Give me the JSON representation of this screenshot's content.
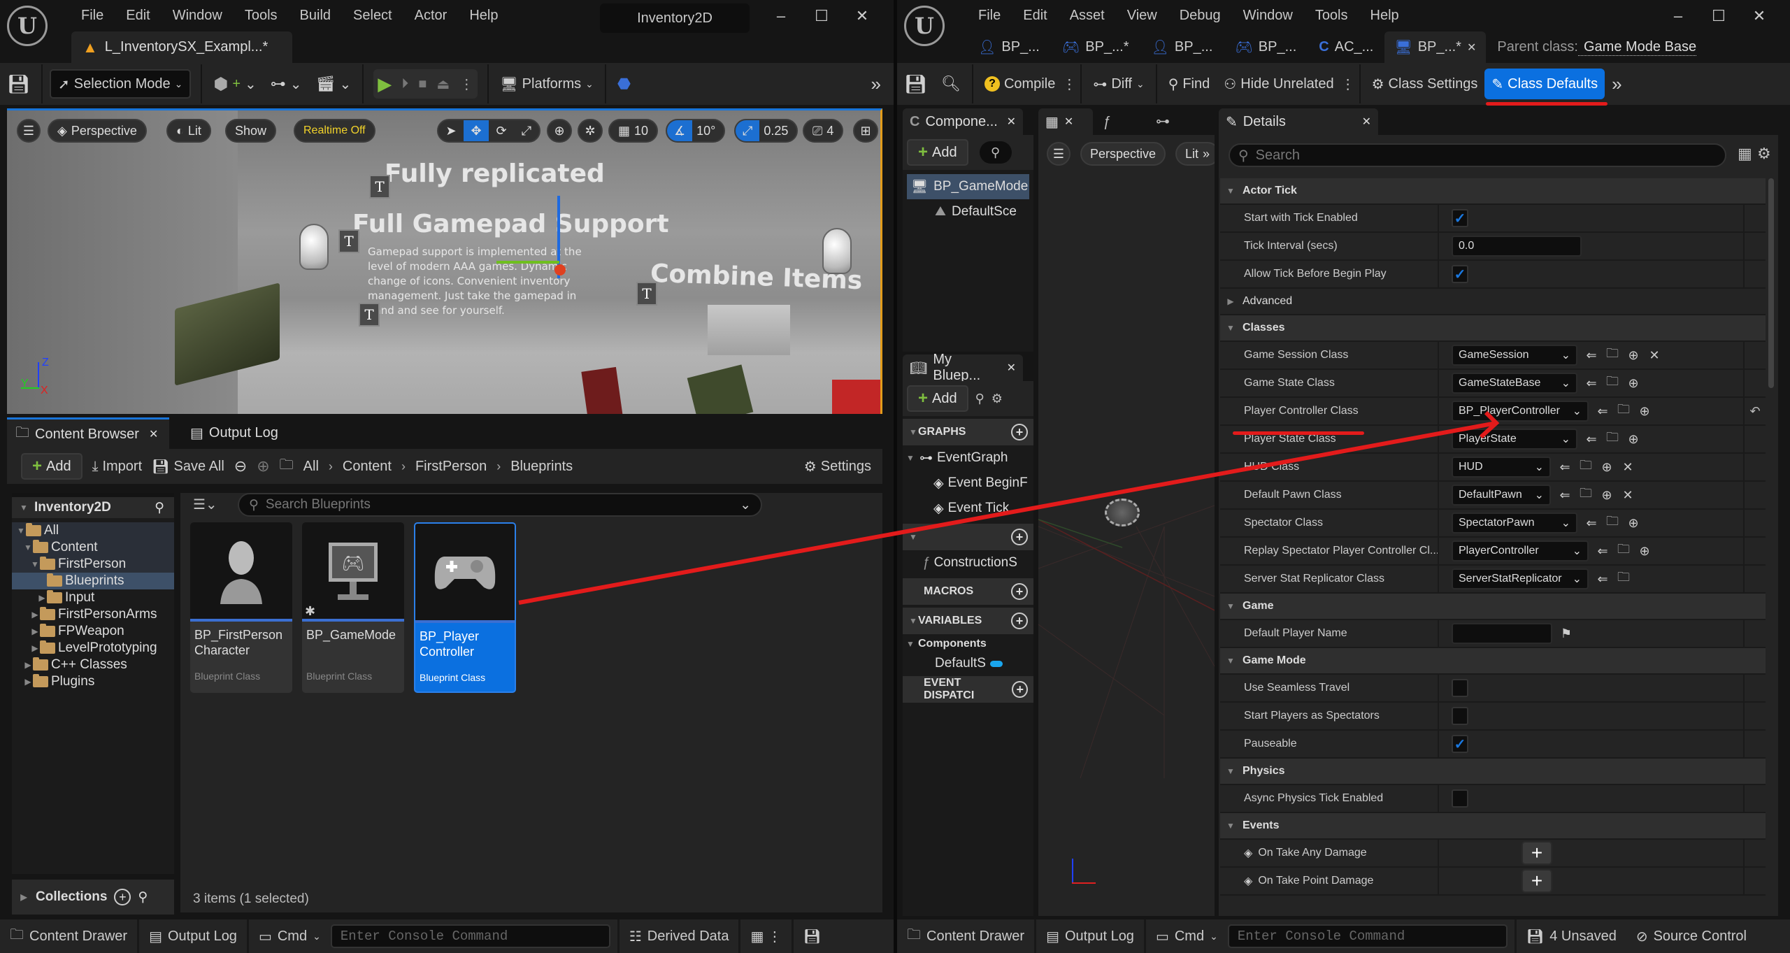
{
  "left_window": {
    "menu": [
      "File",
      "Edit",
      "Window",
      "Tools",
      "Build",
      "Select",
      "Actor",
      "Help"
    ],
    "title": "Inventory2D",
    "doc_tab": "L_InventorySX_Exampl...*",
    "toolbar": {
      "selection_mode": "Selection Mode",
      "platforms": "Platforms"
    },
    "viewport": {
      "perspective": "Perspective",
      "lit": "Lit",
      "show": "Show",
      "realtime": "Realtime Off",
      "grid_snap": "10",
      "rotation_snap": "10°",
      "scale_snap": "0.25",
      "camera_speed": "4",
      "scene_texts": {
        "fully_replicated": "Fully replicated",
        "gamepad_title": "Full Gamepad Support",
        "gamepad_body": "Gamepad support is implemented at the level of modern AAA games. Dynamic change of icons. Convenient inventory management. Just take the gamepad in hand and see for yourself.",
        "combine": "Combine Items"
      },
      "axis": {
        "x": "X",
        "y": "Y",
        "z": "Z"
      }
    },
    "content_browser": {
      "tab_label": "Content Browser",
      "output_log_tab": "Output Log",
      "add": "Add",
      "import": "Import",
      "save_all": "Save All",
      "breadcrumb": [
        "All",
        "Content",
        "FirstPerson",
        "Blueprints"
      ],
      "settings": "Settings",
      "tree_root": "Inventory2D",
      "search_placeholder": "Search Blueprints",
      "tree": [
        {
          "label": "All",
          "expanded": true,
          "selected": false
        },
        {
          "label": "Content",
          "expanded": true,
          "selected": false
        },
        {
          "label": "FirstPerson",
          "expanded": true,
          "selected": false
        },
        {
          "label": "Blueprints",
          "expanded": false,
          "selected": true
        },
        {
          "label": "Input",
          "expanded": false,
          "selected": false
        },
        {
          "label": "FirstPersonArms",
          "expanded": false,
          "selected": false
        },
        {
          "label": "FPWeapon",
          "expanded": false,
          "selected": false
        },
        {
          "label": "LevelPrototyping",
          "expanded": false,
          "selected": false
        },
        {
          "label": "C++ Classes",
          "expanded": false,
          "selected": false
        },
        {
          "label": "Plugins",
          "expanded": false,
          "selected": false
        }
      ],
      "assets": [
        {
          "name": "BP_FirstPerson Character",
          "type": "Blueprint Class",
          "icon": "character-icon",
          "selected": false
        },
        {
          "name": "BP_GameMode",
          "type": "Blueprint Class",
          "icon": "game-mode-icon",
          "selected": false
        },
        {
          "name": "BP_Player Controller",
          "type": "Blueprint Class",
          "icon": "gamepad-icon",
          "selected": true
        }
      ],
      "collections": "Collections",
      "item_count": "3 items (1 selected)"
    },
    "statusbar": {
      "content_drawer": "Content Drawer",
      "output_log": "Output Log",
      "cmd": "Cmd",
      "console_placeholder": "Enter Console Command",
      "derived_data": "Derived Data"
    }
  },
  "right_window": {
    "menu": [
      "File",
      "Edit",
      "Asset",
      "View",
      "Debug",
      "Window",
      "Tools",
      "Help"
    ],
    "tabs": [
      {
        "label": "BP_...",
        "icon": "character-icon"
      },
      {
        "label": "BP_...*",
        "icon": "gamepad-icon"
      },
      {
        "label": "BP_...",
        "icon": "character-icon"
      },
      {
        "label": "BP_...",
        "icon": "gamepad-icon"
      },
      {
        "label": "AC_...",
        "icon": "component-icon"
      },
      {
        "label": "BP_...*",
        "icon": "game-mode-icon",
        "active": true
      }
    ],
    "parent_class_label": "Parent class:",
    "parent_class_value": "Game Mode Base",
    "toolbar": {
      "compile": "Compile",
      "diff": "Diff",
      "find": "Find",
      "hide_unrelated": "Hide Unrelated",
      "class_settings": "Class Settings",
      "class_defaults": "Class Defaults"
    },
    "components": {
      "tab": "Compone...",
      "add": "Add",
      "items": [
        "BP_GameMode",
        "DefaultSce"
      ]
    },
    "viewport": {
      "perspective": "Perspective",
      "lit": "Lit"
    },
    "my_blueprint": {
      "tab": "My Bluep...",
      "add": "Add",
      "graphs_header": "GRAPHS",
      "event_graph": "EventGraph",
      "events": [
        "Event BeginF",
        "Event Tick"
      ],
      "functions": [
        "ConstructionS"
      ],
      "macros_header": "MACROS",
      "variables_header": "VARIABLES",
      "components_group": "Components",
      "variable_items": [
        "DefaultS"
      ],
      "dispatchers_header": "EVENT DISPATCI"
    },
    "details": {
      "tab": "Details",
      "search_placeholder": "Search",
      "categories": [
        {
          "name": "Actor Tick",
          "rows": [
            {
              "label": "Start with Tick Enabled",
              "kind": "check",
              "value": true
            },
            {
              "label": "Tick Interval (secs)",
              "kind": "number",
              "value": "0.0"
            },
            {
              "label": "Allow Tick Before Begin Play",
              "kind": "check",
              "value": true
            }
          ]
        },
        {
          "name": "Advanced",
          "collapsed": true,
          "rows": []
        },
        {
          "name": "Classes",
          "rows": [
            {
              "label": "Game Session Class",
              "kind": "class",
              "value": "GameSession",
              "clear": true
            },
            {
              "label": "Game State Class",
              "kind": "class",
              "value": "GameStateBase",
              "clear": false
            },
            {
              "label": "Player Controller Class",
              "kind": "class",
              "value": "BP_PlayerController",
              "clear": false,
              "modified": true
            },
            {
              "label": "Player State Class",
              "kind": "class",
              "value": "PlayerState",
              "clear": false
            },
            {
              "label": "HUD Class",
              "kind": "class",
              "value": "HUD",
              "clear": true
            },
            {
              "label": "Default Pawn Class",
              "kind": "class",
              "value": "DefaultPawn",
              "clear": true
            },
            {
              "label": "Spectator Class",
              "kind": "class",
              "value": "SpectatorPawn",
              "clear": false
            },
            {
              "label": "Replay Spectator Player Controller Cl...",
              "kind": "class",
              "value": "PlayerController",
              "clear": false
            },
            {
              "label": "Server Stat Replicator Class",
              "kind": "class",
              "value": "ServerStatReplicator",
              "clear": false,
              "noadd": true
            }
          ]
        },
        {
          "name": "Game",
          "rows": [
            {
              "label": "Default Player Name",
              "kind": "text",
              "value": ""
            }
          ]
        },
        {
          "name": "Game Mode",
          "rows": [
            {
              "label": "Use Seamless Travel",
              "kind": "check",
              "value": false
            },
            {
              "label": "Start Players as Spectators",
              "kind": "check",
              "value": false
            },
            {
              "label": "Pauseable",
              "kind": "check",
              "value": true
            }
          ]
        },
        {
          "name": "Physics",
          "rows": [
            {
              "label": "Async Physics Tick Enabled",
              "kind": "check",
              "value": false
            }
          ]
        },
        {
          "name": "Events",
          "rows": [
            {
              "label": "On Take Any Damage",
              "kind": "event"
            },
            {
              "label": "On Take Point Damage",
              "kind": "event"
            }
          ]
        }
      ]
    },
    "statusbar": {
      "content_drawer": "Content Drawer",
      "output_log": "Output Log",
      "cmd": "Cmd",
      "console_placeholder": "Enter Console Command",
      "unsaved": "4 Unsaved",
      "source_control": "Source Control"
    }
  },
  "colors": {
    "accent": "#0b70e0",
    "annotation": "#e31b1b",
    "folder": "#c49a5b",
    "add_green": "#7fbf3f"
  }
}
